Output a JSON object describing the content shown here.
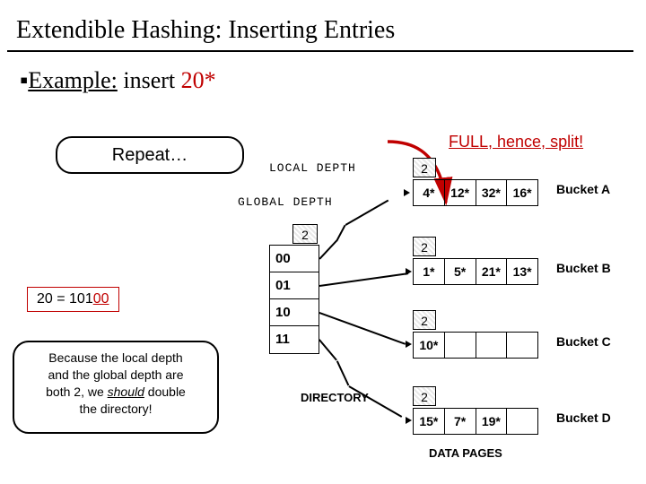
{
  "title": "Extendible Hashing: Inserting Entries",
  "example_prefix": "Example:",
  "example_action": "insert",
  "example_value": "20*",
  "repeat_label": "Repeat…",
  "full_label": "FULL, hence, split!",
  "binary": {
    "prefix": "20 = 101",
    "suffix": "00"
  },
  "because_text_1": "Because the local depth",
  "because_text_2": "and the global depth are",
  "because_text_3": "both 2, we ",
  "because_should": "should",
  "because_text_4": " double",
  "because_text_5": "the directory!",
  "labels": {
    "local_depth": "LOCAL DEPTH",
    "global_depth": "GLOBAL DEPTH",
    "directory": "DIRECTORY",
    "data_pages": "DATA PAGES"
  },
  "directory": {
    "global_depth": "2",
    "entries": [
      "00",
      "01",
      "10",
      "11"
    ]
  },
  "buckets": {
    "A": {
      "label": "Bucket A",
      "local_depth": "2",
      "slots": [
        "4*",
        "12*",
        "32*",
        "16*"
      ]
    },
    "B": {
      "label": "Bucket B",
      "local_depth": "2",
      "slots": [
        "1*",
        "5*",
        "21*",
        "13*"
      ]
    },
    "C": {
      "label": "Bucket C",
      "local_depth": "2",
      "slots": [
        "10*",
        "",
        "",
        ""
      ]
    },
    "D": {
      "label": "Bucket D",
      "local_depth": "2",
      "slots": [
        "15*",
        "7*",
        "19*",
        ""
      ]
    }
  }
}
